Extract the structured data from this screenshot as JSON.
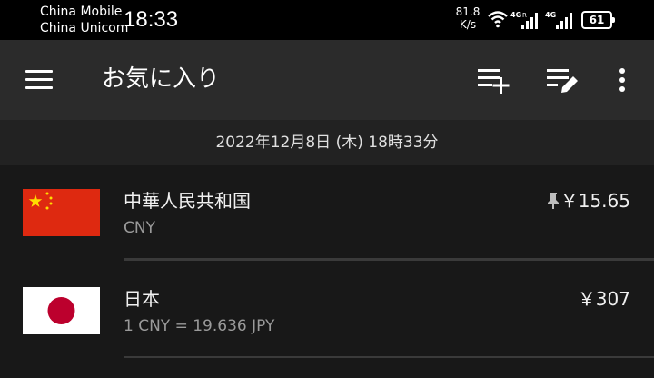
{
  "status_bar": {
    "carrier_1": "China Mobile",
    "carrier_2": "China Unicom",
    "time": "18:33",
    "net_speed_value": "81.8",
    "net_speed_unit": "K/s",
    "battery": "61"
  },
  "toolbar": {
    "title": "お気に入り",
    "menu_icon": "hamburger-menu-icon",
    "add_icon": "playlist-add-icon",
    "edit_icon": "playlist-edit-icon",
    "more_icon": "more-vert-icon"
  },
  "date_header": "2022年12月8日 (木) 18時33分",
  "currencies": [
    {
      "name": "中華人民共和国",
      "subtitle": "CNY",
      "amount": "￥15.65",
      "pinned": true,
      "flag": "china-flag"
    },
    {
      "name": "日本",
      "subtitle": "1 CNY = 19.636 JPY",
      "amount": "￥307",
      "pinned": false,
      "flag": "japan-flag"
    }
  ],
  "colors": {
    "status_bar_bg": "#000000",
    "toolbar_bg": "#2b2b2b",
    "date_bar_bg": "#222222",
    "list_bg": "#181818",
    "china_flag_red": "#de2910",
    "china_flag_yellow": "#ffde00",
    "japan_flag_red": "#bc002d"
  }
}
